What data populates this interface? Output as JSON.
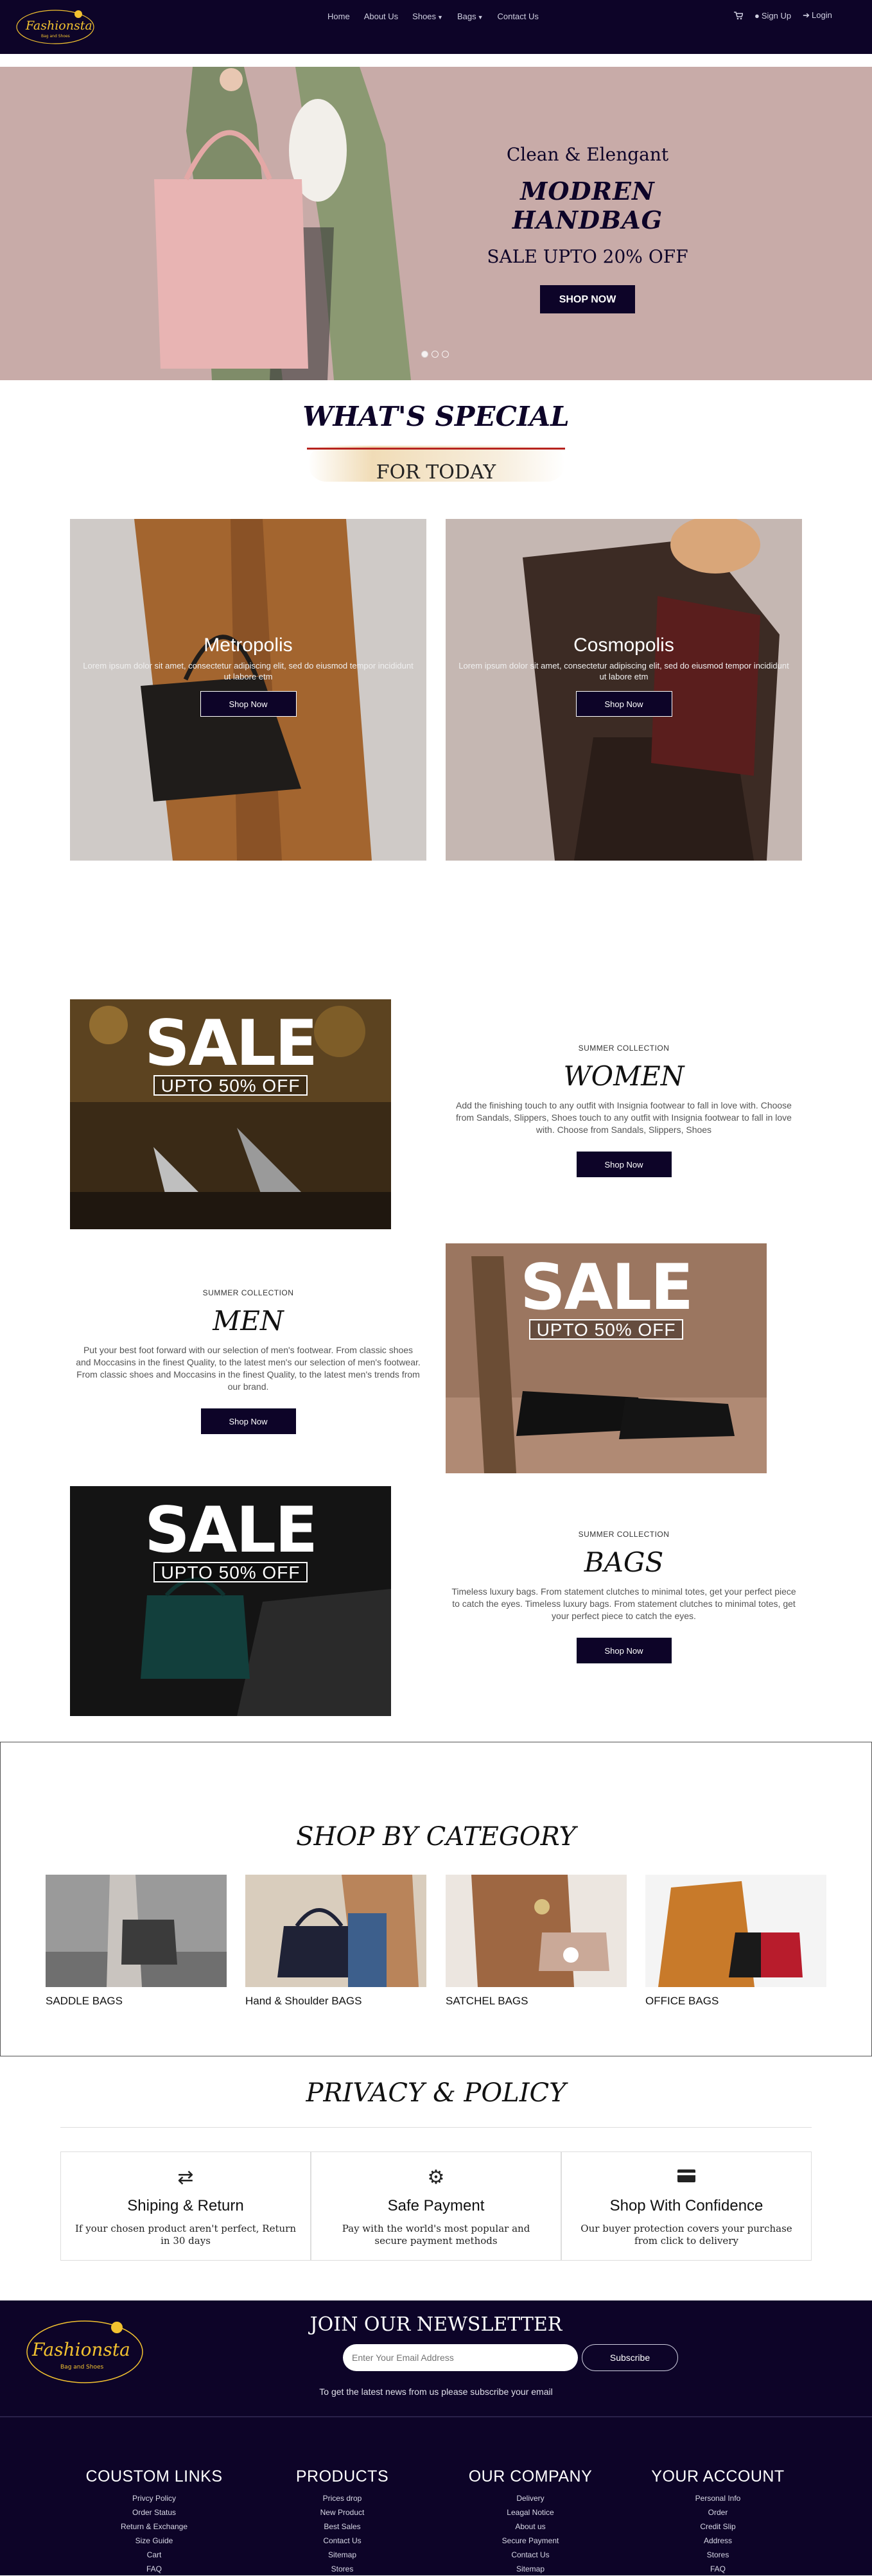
{
  "brand": {
    "name": "Fashionista",
    "tagline": "Bag and Shoes"
  },
  "nav": {
    "items": [
      {
        "label": "Home"
      },
      {
        "label": "About Us"
      },
      {
        "label": "Shoes"
      },
      {
        "label": "Bags"
      },
      {
        "label": "Contact Us"
      }
    ],
    "sign_up": "Sign Up",
    "login": "Login"
  },
  "hero": {
    "line1": "Clean & Elengant",
    "line2": "MODREN HANDBAG",
    "line3": "SALE UPTO 20% OFF",
    "button": "SHOP NOW",
    "slides_total": 3,
    "active_slide": 1
  },
  "special": {
    "title": "WHAT'S SPECIAL",
    "subtitle": "FOR TODAY"
  },
  "collections": [
    {
      "title": "Metropolis",
      "text": "Lorem ipsum dolor sit amet, consectetur adipiscing elit, sed do eiusmod tempor incididunt ut labore etm",
      "button": "Shop Now"
    },
    {
      "title": "Cosmopolis",
      "text": "Lorem ipsum dolor sit amet, consectetur adipiscing elit, sed do eiusmod tempor incididunt ut labore etm",
      "button": "Shop Now"
    }
  ],
  "sale_rows": [
    {
      "sale": "SALE",
      "badge": "UPTO 50% OFF",
      "tag": "SUMMER COLLECTION",
      "title": "WOMEN",
      "text": "Add the finishing touch to any outfit with Insignia footwear to fall in love with. Choose from Sandals, Slippers, Shoes touch to any outfit with Insignia footwear to fall in love with. Choose from Sandals, Slippers, Shoes",
      "button": "Shop Now"
    },
    {
      "sale": "SALE",
      "badge": "UPTO 50% OFF",
      "tag": "SUMMER COLLECTION",
      "title": "MEN",
      "text": "Put your best foot forward with our selection of men's footwear. From classic shoes and Moccasins in the finest Quality, to the latest men's our selection of men's footwear. From classic shoes and Moccasins in the finest Quality, to the latest men's trends from our brand.",
      "button": "Shop Now"
    },
    {
      "sale": "SALE",
      "badge": "UPTO 50% OFF",
      "tag": "SUMMER COLLECTION",
      "title": "BAGS",
      "text": "Timeless luxury bags. From statement clutches to minimal totes, get your perfect piece to catch the eyes. Timeless luxury bags. From statement clutches to minimal totes, get your perfect piece to catch the eyes.",
      "button": "Shop Now"
    }
  ],
  "categories": {
    "title": "SHOP BY CATEGORY",
    "items": [
      {
        "label": "SADDLE BAGS"
      },
      {
        "label": "Hand & Shoulder BAGS"
      },
      {
        "label": "SATCHEL BAGS"
      },
      {
        "label": "OFFICE BAGS"
      }
    ]
  },
  "privacy": {
    "title": "PRIVACY & POLICY",
    "items": [
      {
        "icon": "exchange-icon",
        "title": "Shiping & Return",
        "text": "If your chosen product aren't perfect, Return in 30 days"
      },
      {
        "icon": "gear-icon",
        "title": "Safe Payment",
        "text": "Pay with the world's most popular and secure payment methods"
      },
      {
        "icon": "credit-card-icon",
        "title": "Shop With Confidence",
        "text": "Our buyer protection covers your purchase from click to delivery"
      }
    ]
  },
  "newsletter": {
    "title": "JOIN OUR NEWSLETTER",
    "placeholder": "Enter Your Email Address",
    "button": "Subscribe",
    "note": "To get the latest news from us please subscribe your email"
  },
  "footer": {
    "columns": [
      {
        "title": "COUSTOM LINKS",
        "links": [
          "Privcy Policy",
          "Order Status",
          "Return & Exchange",
          "Size Guide",
          "Cart",
          "FAQ"
        ]
      },
      {
        "title": "PRODUCTS",
        "links": [
          "Prices drop",
          "New Product",
          "Best Sales",
          "Contact Us",
          "Sitemap",
          "Stores"
        ]
      },
      {
        "title": "OUR COMPANY",
        "links": [
          "Delivery",
          "Leagal Notice",
          "About us",
          "Secure Payment",
          "Contact Us",
          "Sitemap"
        ]
      },
      {
        "title": "YOUR ACCOUNT",
        "links": [
          "Personal Info",
          "Order",
          "Credit Slip",
          "Address",
          "Stores",
          "FAQ"
        ]
      }
    ]
  },
  "colors": {
    "primary": "#0d0428",
    "hero_bg": "#c8aba8",
    "accent_red": "#b7231e",
    "gold": "#f2c230"
  }
}
